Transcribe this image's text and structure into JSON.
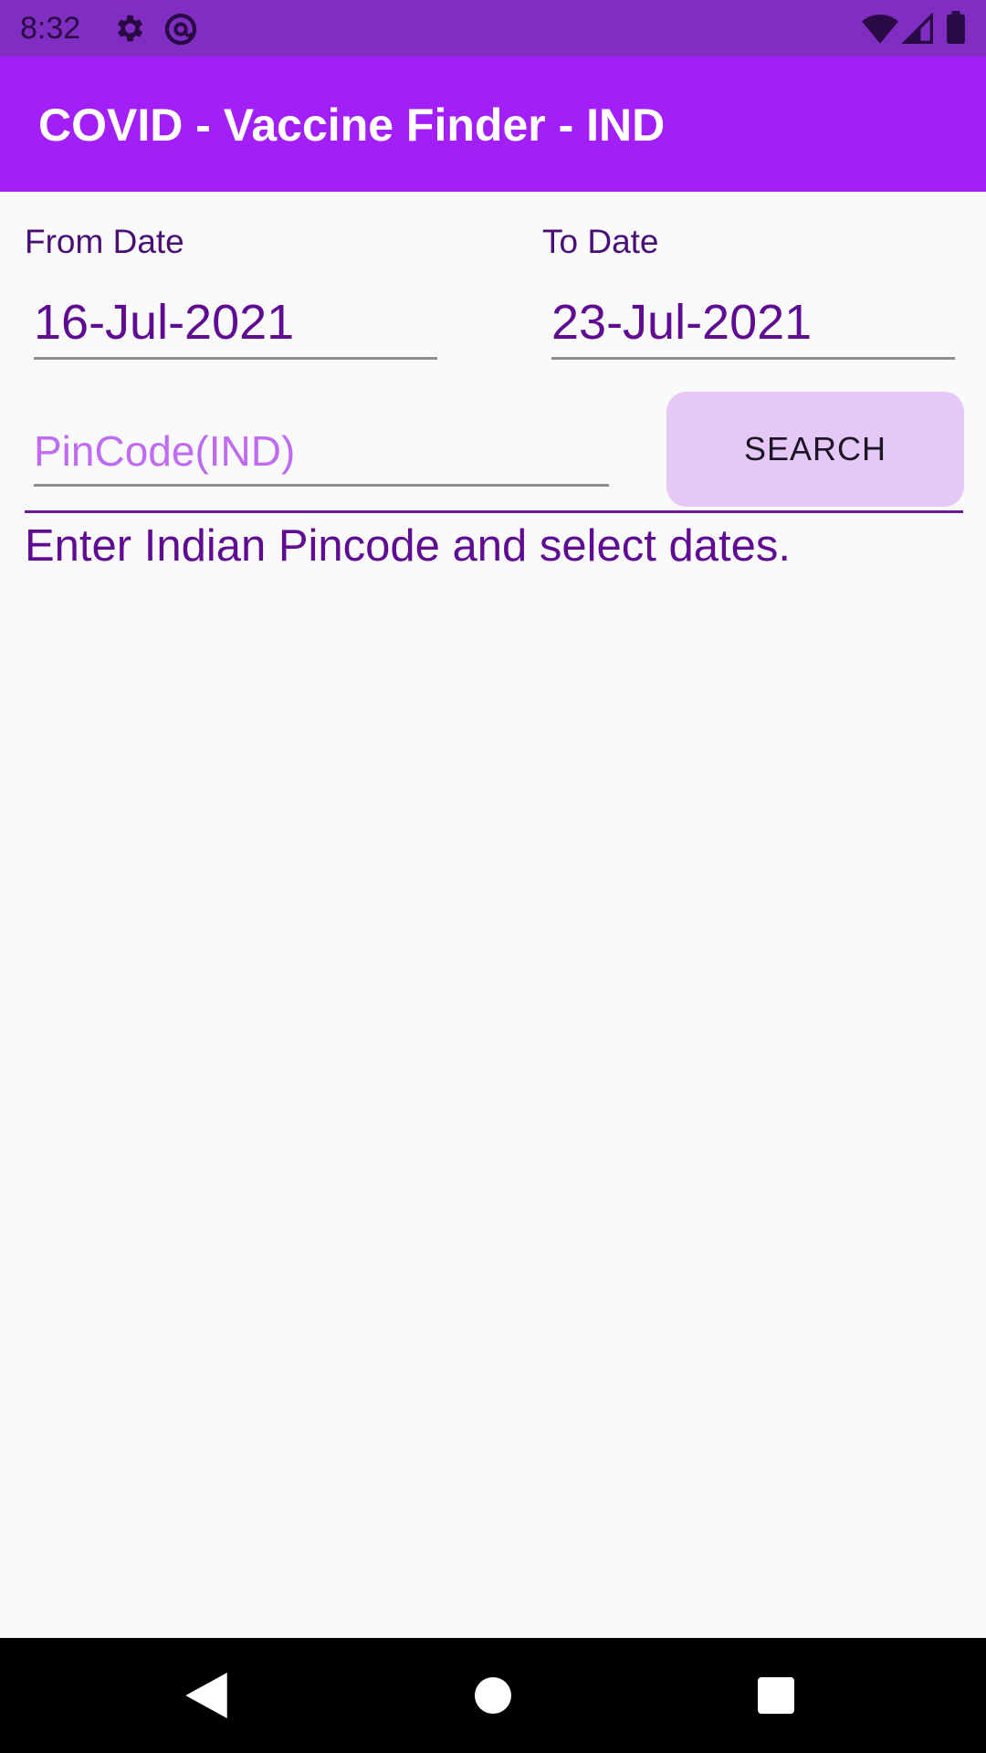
{
  "status_bar": {
    "time": "8:32",
    "icons": [
      "gear-icon",
      "at-sign-icon",
      "wifi-icon",
      "signal-icon",
      "battery-icon"
    ]
  },
  "app_bar": {
    "title": "COVID - Vaccine Finder - IND"
  },
  "form": {
    "from_date_label": "From Date",
    "from_date_value": "16-Jul-2021",
    "to_date_label": "To Date",
    "to_date_value": "23-Jul-2021",
    "pincode_placeholder": "PinCode(IND)",
    "search_label": "SEARCH"
  },
  "message": "Enter Indian Pincode and select dates.",
  "nav_bar": {
    "buttons": [
      "back-icon",
      "home-icon",
      "recents-icon"
    ]
  },
  "colors": {
    "status_bar": "#7f2ec1",
    "app_bar": "#a31ff7",
    "accent_text": "#5f0c92",
    "button_bg": "#e5c8f5",
    "placeholder": "#c06cf0"
  }
}
